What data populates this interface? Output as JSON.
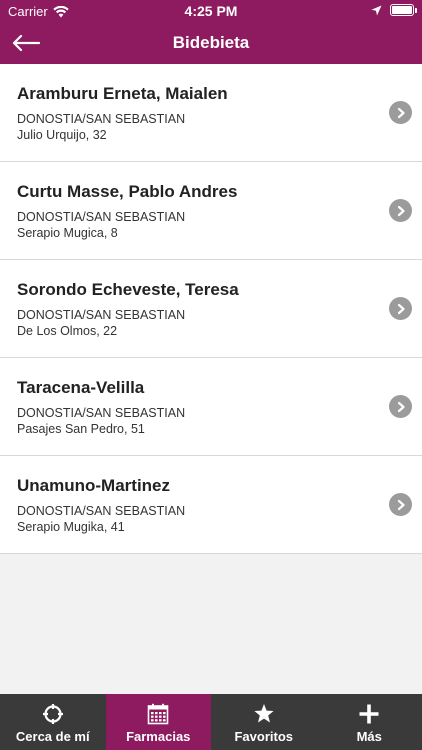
{
  "status_bar": {
    "carrier": "Carrier",
    "time": "4:25 PM"
  },
  "nav": {
    "title": "Bidebieta"
  },
  "pharmacies": [
    {
      "name": "Aramburu Erneta, Maialen",
      "city": "DONOSTIA/SAN SEBASTIAN",
      "address": "Julio Urquijo, 32"
    },
    {
      "name": "Curtu Masse, Pablo Andres",
      "city": "DONOSTIA/SAN SEBASTIAN",
      "address": "Serapio Mugica, 8"
    },
    {
      "name": "Sorondo Echeveste, Teresa",
      "city": "DONOSTIA/SAN SEBASTIAN",
      "address": "De Los Olmos, 22"
    },
    {
      "name": "Taracena-Velilla",
      "city": "DONOSTIA/SAN SEBASTIAN",
      "address": "Pasajes San Pedro, 51"
    },
    {
      "name": "Unamuno-Martinez",
      "city": "DONOSTIA/SAN SEBASTIAN",
      "address": "Serapio Mugika, 41"
    }
  ],
  "tabs": [
    {
      "label": "Cerca de mí",
      "icon": "crosshair-icon",
      "active": false
    },
    {
      "label": "Farmacias",
      "icon": "calendar-icon",
      "active": true
    },
    {
      "label": "Favoritos",
      "icon": "star-icon",
      "active": false
    },
    {
      "label": "Más",
      "icon": "plus-icon",
      "active": false
    }
  ],
  "colors": {
    "brand": "#8e1a5f",
    "tab_bar": "#3a3a3a",
    "chevron": "#9b9b9b",
    "background": "#f2f2f2"
  }
}
